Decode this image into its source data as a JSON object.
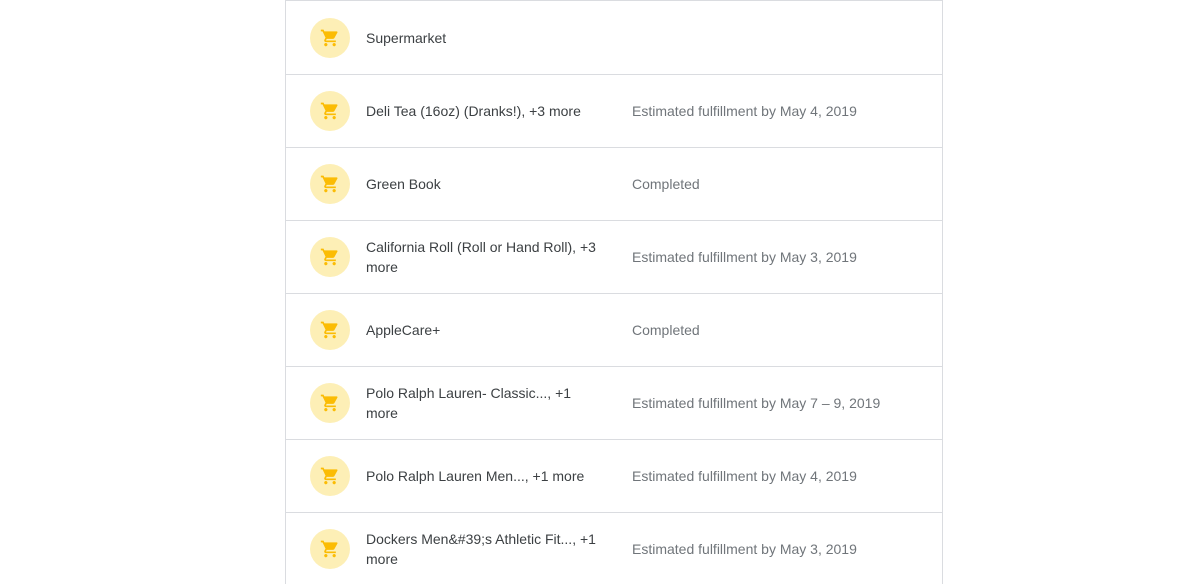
{
  "orders": [
    {
      "title": "Supermarket",
      "status": ""
    },
    {
      "title": "Deli Tea (16oz) (Dranks!), +3 more",
      "status": "Estimated fulfillment by May 4, 2019"
    },
    {
      "title": "Green Book",
      "status": "Completed"
    },
    {
      "title": "California Roll (Roll or Hand Roll), +3 more",
      "status": "Estimated fulfillment by May 3, 2019"
    },
    {
      "title": "AppleCare+",
      "status": "Completed"
    },
    {
      "title": "Polo Ralph Lauren- Classic..., +1 more",
      "status": "Estimated fulfillment by May 7 – 9, 2019"
    },
    {
      "title": "Polo Ralph Lauren Men..., +1 more",
      "status": "Estimated fulfillment by May 4, 2019"
    },
    {
      "title": "Dockers Men&#39;s Athletic Fit..., +1 more",
      "status": "Estimated fulfillment by May 3, 2019"
    }
  ],
  "icon": "shopping-cart-icon",
  "colors": {
    "icon_bg": "#fdefb6",
    "icon_fg": "#fbbc04",
    "divider": "#dadce0",
    "title_text": "#3c4043",
    "status_text": "#70757a"
  }
}
